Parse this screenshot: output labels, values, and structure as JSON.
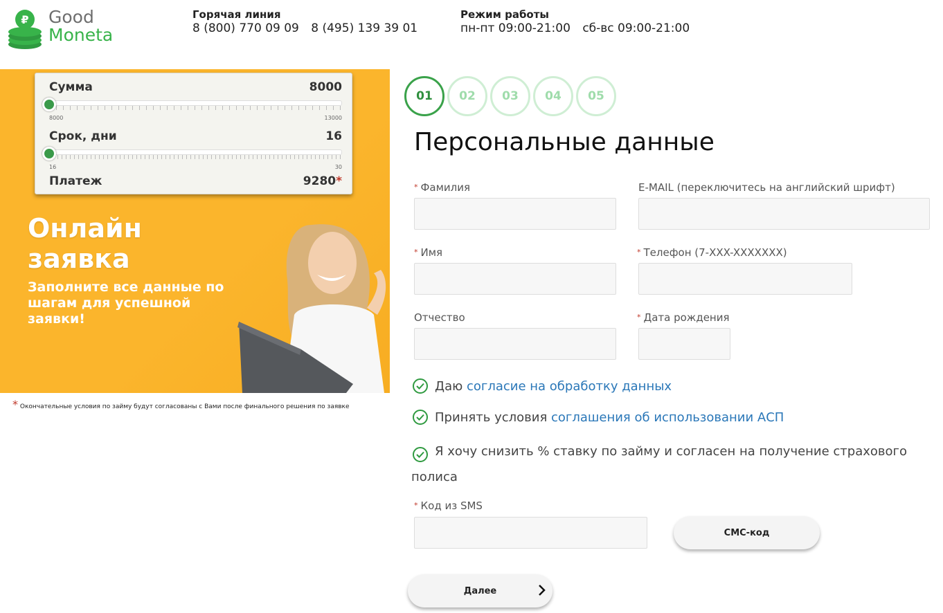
{
  "logo": {
    "line1": "Good",
    "line2": "Moneta"
  },
  "header": {
    "hotline_title": "Горячая линия",
    "phones": [
      "8 (800) 770 09 09",
      "8 (495) 139 39 01"
    ],
    "hours_title": "Режим работы",
    "hours": [
      "пн-пт 09:00-21:00",
      "сб-вс 09:00-21:00"
    ]
  },
  "calculator": {
    "amount_label": "Сумма",
    "amount_value": "8000",
    "amount_min": "8000",
    "amount_max": "13000",
    "amount_fraction": 0.0,
    "term_label": "Срок, дни",
    "term_value": "16",
    "term_min": "16",
    "term_max": "30",
    "term_fraction": 0.0,
    "payment_label": "Платеж",
    "payment_value": "9280",
    "asterisk": "*"
  },
  "promo": {
    "title_line1": "Онлайн",
    "title_line2": "заявка",
    "subtitle": "Заполните все данные по шагам для успешной заявки!"
  },
  "footnote": {
    "asterisk": "*",
    "text": "Окончательные условия по займу будут согласованы с Вами после финального решения по заявке"
  },
  "steps": [
    "01",
    "02",
    "03",
    "04",
    "05"
  ],
  "active_step": "01",
  "page_title": "Персональные данные",
  "form": {
    "required_mark": "*",
    "surname_label": "Фамилия",
    "email_label": "E-MAIL (переключитесь на английский шрифт)",
    "name_label": "Имя",
    "phone_label": "Телефон (7-XXX-XXXXXXX)",
    "patronymic_label": "Отчество",
    "birthdate_label": "Дата рождения",
    "sms_label": "Код из SMS",
    "surname_value": "",
    "email_value": "",
    "name_value": "",
    "phone_value": "",
    "patronymic_value": "",
    "birthdate_value": "",
    "sms_value": ""
  },
  "consents": {
    "c1_prefix": "Даю",
    "c1_link": "согласие на обработку данных",
    "c2_prefix": "Принять условия",
    "c2_link": "соглашения об использовании АСП",
    "c3_text": "Я хочу снизить % ставку по займу и согласен на получение страхового полиса"
  },
  "buttons": {
    "sms": "СМС-код",
    "next": "Далее"
  },
  "colors": {
    "brand_green": "#38b34a",
    "banner_yellow": "#fbb52c",
    "link_blue": "#2a77b8",
    "required_red": "#c0392b"
  }
}
